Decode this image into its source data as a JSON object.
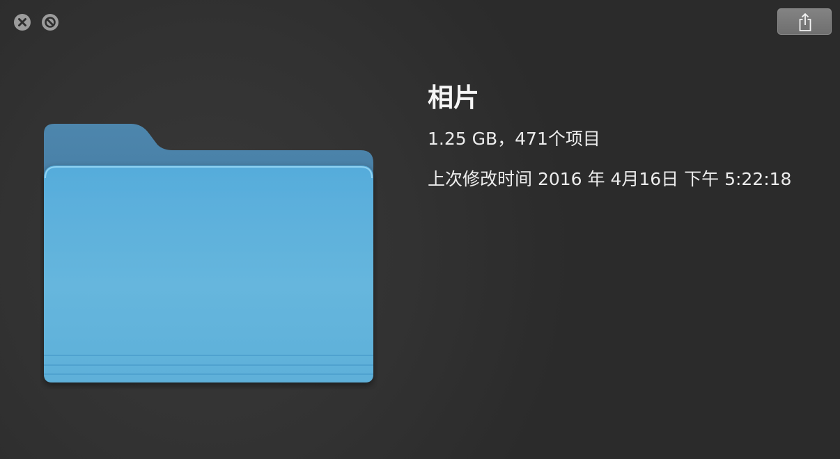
{
  "window": {
    "controls": {
      "close_icon": "close-x-icon",
      "fullscreen_icon": "fullscreen-slash-icon"
    },
    "share_button": {
      "icon": "share-icon"
    }
  },
  "preview": {
    "icon": "folder-icon",
    "folder_color": "#5ab2dc"
  },
  "info": {
    "name": "相片",
    "size_items": "1.25 GB，471个项目",
    "modified": "上次修改时间 2016 年 4月16日 下午 5:22:18"
  }
}
